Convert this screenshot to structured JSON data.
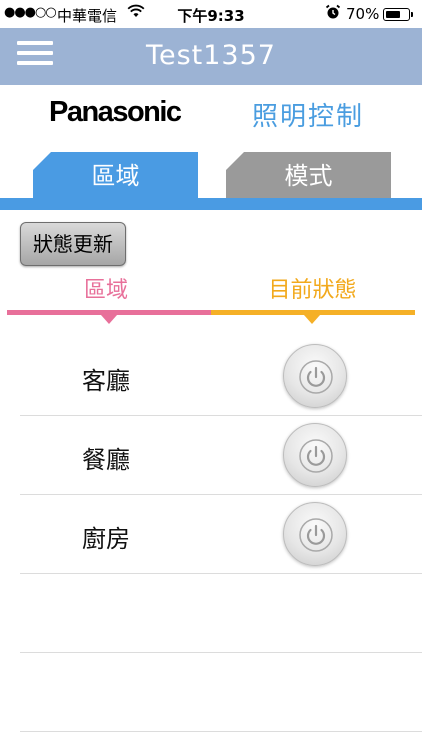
{
  "status_bar": {
    "signal": "●●●○○",
    "carrier": "中華電信",
    "time": "下午9:33",
    "battery_percent": "70%",
    "battery_level": 0.7
  },
  "header": {
    "title": "Test1357",
    "menu_icon": "hamburger-menu-icon"
  },
  "brand": {
    "logo": "Panasonic",
    "title": "照明控制"
  },
  "tabs": [
    {
      "label": "區域",
      "active": true
    },
    {
      "label": "模式",
      "active": false
    }
  ],
  "toolbar": {
    "refresh_label": "狀態更新"
  },
  "table": {
    "columns": [
      "區域",
      "目前狀態"
    ],
    "rows": [
      {
        "name": "客廳",
        "status_icon": "power-icon"
      },
      {
        "name": "餐廳",
        "status_icon": "power-icon"
      },
      {
        "name": "廚房",
        "status_icon": "power-icon"
      }
    ],
    "empty_rows": 2
  },
  "colors": {
    "nav": "#9cb3d4",
    "tab_active": "#4a9be3",
    "tab_inactive": "#9a9a9a",
    "col_area": "#e8709a",
    "col_status": "#f5b027",
    "brand_title": "#4a9de0"
  }
}
